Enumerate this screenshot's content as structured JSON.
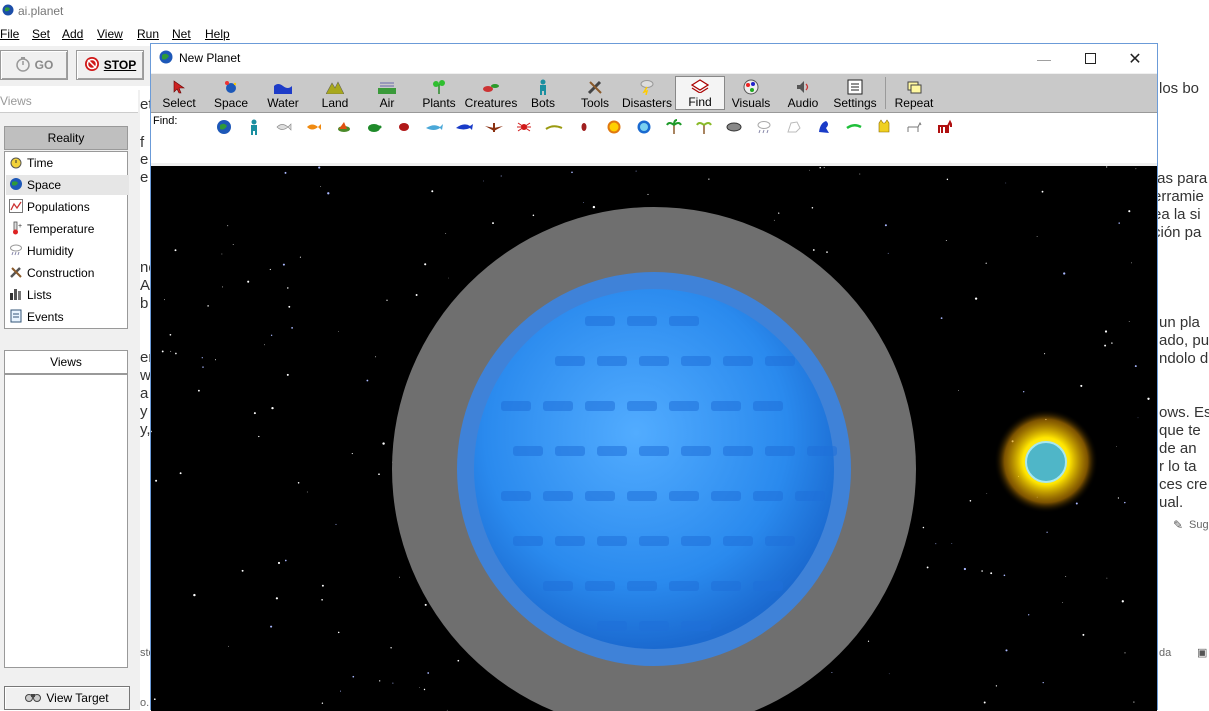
{
  "app": {
    "title": "ai.planet"
  },
  "menu": [
    "File",
    "Set",
    "Add",
    "View",
    "Run",
    "Net",
    "Help"
  ],
  "main_toolbar": {
    "go_label": "GO",
    "stop_label": "STOP"
  },
  "left_panel": {
    "views_header": "Views",
    "reality_tab": "Reality",
    "reality_items": [
      "Time",
      "Space",
      "Populations",
      "Temperature",
      "Humidity",
      "Construction",
      "Lists",
      "Events"
    ],
    "selected_item": "Space",
    "views_tab": "Views",
    "view_target_label": "View Target"
  },
  "child_window": {
    "title": "New Planet",
    "tools": [
      "Select",
      "Space",
      "Water",
      "Land",
      "Air",
      "Plants",
      "Creatures",
      "Bots",
      "Tools",
      "Disasters",
      "Find",
      "Visuals",
      "Audio",
      "Settings",
      "Repeat"
    ],
    "active_tool": "Find",
    "find_label": "Find:",
    "find_icons": [
      "planet-icon",
      "human-icon",
      "fish-outline-icon",
      "orange-fish-icon",
      "bird-icon",
      "turtle-icon",
      "beetle-icon",
      "shark-icon",
      "dolphin-icon",
      "eagle-icon",
      "spider-icon",
      "lizard-icon",
      "seed-icon",
      "sun-icon",
      "water-drop-icon",
      "palm-tree-icon",
      "palm-tree-small-icon",
      "rock-icon",
      "cloud-icon",
      "ghost-icon",
      "blue-bird-icon",
      "green-lizard-icon",
      "cat-icon",
      "dog-icon",
      "horse-icon"
    ]
  },
  "background_page": {
    "left_fragments": [
      "et",
      "f",
      "e",
      "e",
      "ne",
      "A",
      "b",
      "er",
      "w",
      "a",
      "y",
      "y,"
    ],
    "right_fragments": [
      "los bo",
      "tas para",
      "erramie",
      "ea la si",
      "ción pa",
      "un pla",
      "ado, pu",
      "ndolo d",
      "ows. Es",
      "que te",
      "de an",
      "r lo ta",
      "ces cre",
      "ual."
    ],
    "right_small": [
      "Sug",
      "da"
    ],
    "left_small": [
      "sto",
      "o..."
    ]
  },
  "colors": {
    "space": "#000000",
    "halo": "#6f6f6f",
    "planet_outer": "#3f82d8",
    "planet_core": "#2e8ff0",
    "sun_glow": "#ffe600",
    "sun_core": "#4fb6c8"
  }
}
